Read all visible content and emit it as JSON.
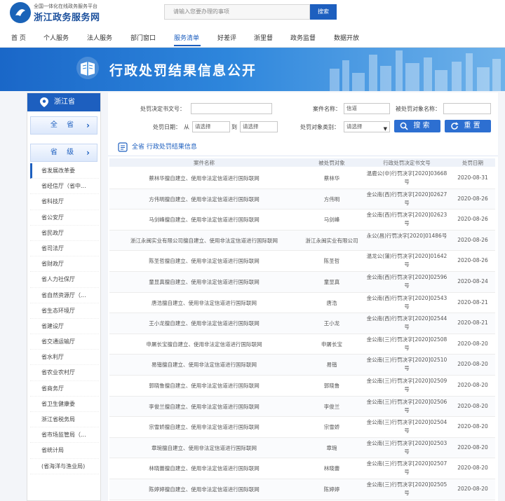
{
  "header": {
    "subtitle": "全国一体化在线政务服务平台",
    "site_name": "浙江政务服务网",
    "search_placeholder": "请输入您要办理的事项",
    "search_button": "搜索"
  },
  "nav": [
    "首 页",
    "个人服务",
    "法人服务",
    "部门窗口",
    "服务清单",
    "好差评",
    "浙里督",
    "政务监督",
    "数据开放"
  ],
  "nav_active": "服务清单",
  "banner": {
    "title": "行政处罚结果信息公开"
  },
  "sidebar": {
    "province": "浙江省",
    "all_button": "全 省",
    "level_button": "省 级",
    "departments": [
      "省发展改革委",
      "省经信厅（省中...",
      "省科技厅",
      "省公安厅",
      "省民政厅",
      "省司法厅",
      "省财政厅",
      "省人力社保厅",
      "省自然资源厅（...",
      "省生态环境厅",
      "省建设厅",
      "省交通运输厅",
      "省水利厅",
      "省农业农村厅",
      "省商务厅",
      "省卫生健康委",
      "浙江省税务局",
      "省市场监管局（...",
      "省统计局",
      "(省海洋与渔业局)"
    ]
  },
  "filters": {
    "doc_no_label": "处罚决定书文号：",
    "case_name_label": "案件名称：",
    "case_name_value": "信道",
    "target_label": "被处罚对象名称：",
    "date_label": "处罚日期：",
    "from_label": "从",
    "to_label": "到",
    "date_from": "请选择",
    "date_to": "请选择",
    "target_type_label": "处罚对象类别：",
    "target_type_value": "请选择",
    "search_button": "搜 索",
    "reset_button": "重 置"
  },
  "section_title": "全省 行政处罚结果信息",
  "table": {
    "headers": [
      "案件名称",
      "被处罚对象",
      "行政处罚决定书文号",
      "处罚日期"
    ],
    "rows": [
      {
        "name": "蔡林华擅自建立、使用非法定信道进行国际联网",
        "party": "蔡林华",
        "doc": "温鹿公(中)行罚决字[2020]03668号",
        "date": "2020-08-31"
      },
      {
        "name": "方伟明擅自建立、使用非法定信道进行国际联网",
        "party": "方伟明",
        "doc": "金公南(西)行罚决字[2020]02627号",
        "date": "2020-08-26"
      },
      {
        "name": "马剑峰擅自建立、使用非法定信道进行国际联网",
        "party": "马剑峰",
        "doc": "金公南(西)行罚决字[2020]02623号",
        "date": "2020-08-26"
      },
      {
        "name": "浙江永闽实业有限公司擅自建立、使用非法定信道进行国际联网",
        "party": "浙江永闽实业有限公司",
        "doc": "永公(昌)行罚决字[2020]01486号",
        "date": "2020-08-26"
      },
      {
        "name": "陈圣哲擅自建立、使用非法定信道进行国际联网",
        "party": "陈圣哲",
        "doc": "温龙公(蒲)行罚决字[2020]01642号",
        "date": "2020-08-26"
      },
      {
        "name": "童显真擅自建立、使用非法定信道进行国际联网",
        "party": "童显真",
        "doc": "金公南(西)行罚决字[2020]02596号",
        "date": "2020-08-24"
      },
      {
        "name": "唐浩擅自建立、使用非法定信道进行国际联网",
        "party": "唐浩",
        "doc": "金公南(西)行罚决字[2020]02543号",
        "date": "2020-08-21"
      },
      {
        "name": "王小龙擅自建立、使用非法定信道进行国际联网",
        "party": "王小龙",
        "doc": "金公南(西)行罚决字[2020]02544号",
        "date": "2020-08-21"
      },
      {
        "name": "申屠长宝擅自建立、使用非法定信道进行国际联网",
        "party": "申屠长宝",
        "doc": "金公南(三)行罚决字[2020]02508号",
        "date": "2020-08-20"
      },
      {
        "name": "易锴擅自建立、使用非法定信道进行国际联网",
        "party": "易锴",
        "doc": "金公南(三)行罚决字[2020]02510号",
        "date": "2020-08-20"
      },
      {
        "name": "郭晓鲁擅自建立、使用非法定信道进行国际联网",
        "party": "郭晓鲁",
        "doc": "金公南(三)行罚决字[2020]02509号",
        "date": "2020-08-20"
      },
      {
        "name": "李俊兰擅自建立、使用非法定信道进行国际联网",
        "party": "李俊兰",
        "doc": "金公南(三)行罚决字[2020]02506号",
        "date": "2020-08-20"
      },
      {
        "name": "宗雪娇擅自建立、使用非法定信道进行国际联网",
        "party": "宗雪娇",
        "doc": "金公南(三)行罚决字[2020]02504号",
        "date": "2020-08-20"
      },
      {
        "name": "章琬擅自建立、使用非法定信道进行国际联网",
        "party": "章琬",
        "doc": "金公南(三)行罚决字[2020]02503号",
        "date": "2020-08-20"
      },
      {
        "name": "林晓蕾擅自建立、使用非法定信道进行国际联网",
        "party": "林晓蕾",
        "doc": "金公南(三)行罚决字[2020]02507号",
        "date": "2020-08-20"
      },
      {
        "name": "陈婷婷擅自建立、使用非法定信道进行国际联网",
        "party": "陈婷婷",
        "doc": "金公南(三)行罚决字[2020]02505号",
        "date": "2020-08-20"
      }
    ]
  },
  "colors": {
    "primary": "#1d5fbf",
    "banner_start": "#1a67c8",
    "banner_end": "#6fb2ea"
  }
}
